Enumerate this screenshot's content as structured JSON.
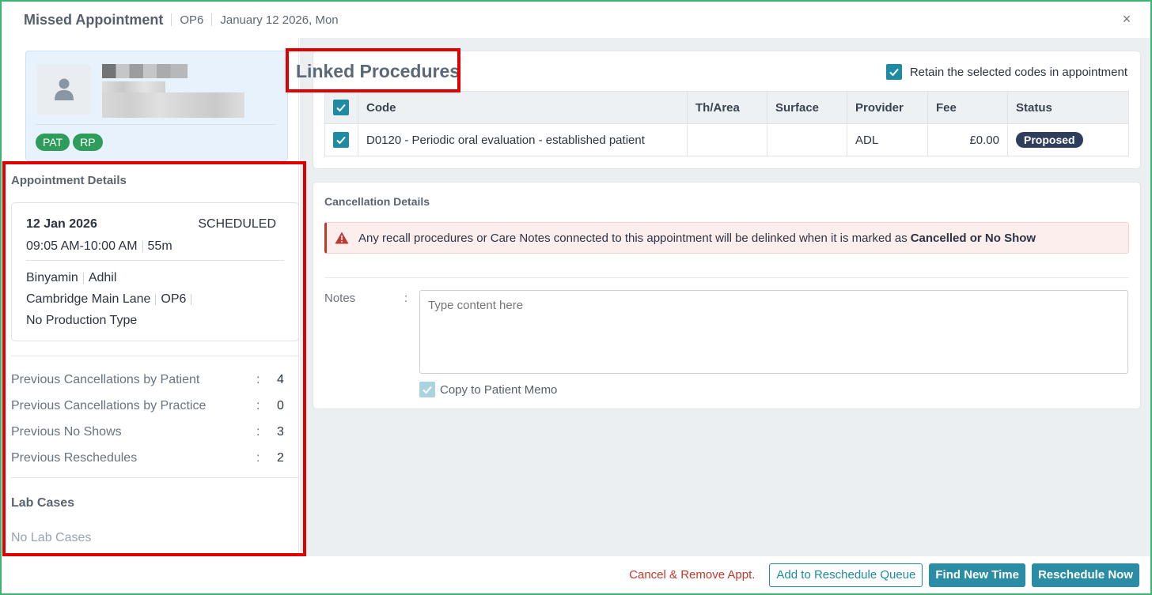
{
  "header": {
    "title": "Missed Appointment",
    "operatory": "OP6",
    "date": "January 12 2026, Mon",
    "close_icon": "×"
  },
  "patient": {
    "avatar_icon": "person-icon",
    "badges": [
      "PAT",
      "RP"
    ]
  },
  "appointment_details": {
    "label": "Appointment Details",
    "date": "12 Jan 2026",
    "status": "SCHEDULED",
    "time": "09:05 AM-10:00 AM",
    "duration": "55m",
    "provider1": "Binyamin",
    "provider2": "Adhil",
    "location": "Cambridge Main Lane",
    "room": "OP6",
    "production_type": "No Production Type"
  },
  "stats": [
    {
      "label": "Previous Cancellations by Patient",
      "value": "4"
    },
    {
      "label": "Previous Cancellations by Practice",
      "value": "0"
    },
    {
      "label": "Previous No Shows",
      "value": "3"
    },
    {
      "label": "Previous Reschedules",
      "value": "2"
    }
  ],
  "stats_colon": ":",
  "lab_cases": {
    "label": "Lab Cases",
    "empty": "No Lab Cases"
  },
  "linked_procedures": {
    "title": "Linked Procedures",
    "retain_label": "Retain the selected codes in appointment",
    "columns": [
      "Code",
      "Th/Area",
      "Surface",
      "Provider",
      "Fee",
      "Status"
    ],
    "rows": [
      {
        "code": "D0120 - Periodic oral evaluation - established patient",
        "th_area": "",
        "surface": "",
        "provider": "ADL",
        "fee": "£0.00",
        "status": "Proposed"
      }
    ]
  },
  "cancellation": {
    "title": "Cancellation Details",
    "alert_text": "Any recall procedures or Care Notes connected to this appointment will be delinked when it is marked as",
    "alert_bold": "Cancelled or No Show",
    "notes_label": "Notes",
    "notes_colon": ":",
    "notes_placeholder": "Type content here",
    "copy_memo_label": "Copy to Patient Memo"
  },
  "footer": {
    "cancel_remove": "Cancel & Remove Appt.",
    "add_queue": "Add to Reschedule Queue",
    "find_time": "Find New Time",
    "reschedule_now": "Reschedule Now"
  },
  "colors": {
    "accent": "#1f8aa3",
    "badge_green": "#2e9c5a",
    "danger": "#c0392b",
    "highlight_red": "#e00000"
  }
}
